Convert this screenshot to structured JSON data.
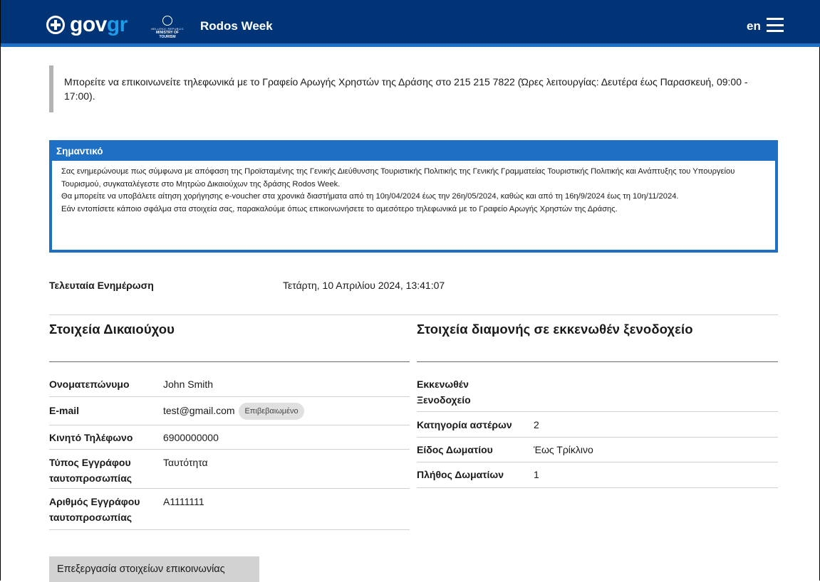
{
  "colors": {
    "header_bg": "#003476",
    "header_accent": "#1e70c4",
    "gov_accent": "#1e9ce9",
    "important_border": "#1e70c4",
    "quote_border": "#b3b3b3",
    "badge_bg": "#e0e0e0",
    "button_bg": "#d2d2d2"
  },
  "header": {
    "logo_text_a": "gov",
    "logo_text_b": "gr",
    "ministry_line1": "HELLENIC REPUBLIC",
    "ministry_line2": "MINISTRY OF TOURISM",
    "app_title": "Rodos Week",
    "language": "en",
    "menu_icon": "hamburger-icon",
    "logo_icon": "greek-emblem-icon"
  },
  "notice": {
    "text": "Μπορείτε να επικοινωνείτε τηλεφωνικά με το Γραφείο Αρωγής Χρηστών της Δράσης στο 215 215 7822 (Ώρες λειτουργίας: Δευτέρα έως Παρασκευή, 09:00 - 17:00)."
  },
  "important": {
    "title": "Σημαντικό",
    "lines": [
      "Σας ενημερώνουμε πως σύμφωνα με απόφαση της Προϊσταμένης της Γενικής Διεύθυνσης Τουριστικής Πολιτικής της Γενικής Γραμματείας Τουριστικής Πολιτικής και Ανάπτυξης του Υπουργείου Τουρισμού, συγκαταλέγεστε στο Μητρώο Δικαιούχων της δράσης Rodos Week.",
      "Θα μπορείτε να υποβάλετε αίτηση χορήγησης e-voucher στα χρονικά διαστήματα από τη 10η/04/2024 έως την 26η/05/2024, καθώς και από τη 16η/9/2024 έως τη 10η/11/2024.",
      "Εάν εντοπίσετε κάποιο σφάλμα στα στοιχεία σας, παρακαλούμε όπως επικοινωνήσετε το αμεσότερο τηλεφωνικά με το Γραφείο Αρωγής Χρηστών της Δράσης."
    ]
  },
  "last_update": {
    "label": "Τελευταία Ενημέρωση",
    "value": "Τετάρτη, 10 Απριλίου 2024, 13:41:07"
  },
  "beneficiary": {
    "title": "Στοιχεία Δικαιούχου",
    "rows": [
      {
        "key": "Ονοματεπώνυμο",
        "value": "John Smith"
      },
      {
        "key": "E-mail",
        "value": "test@gmail.com",
        "badge": "Επιβεβαιωμένο"
      },
      {
        "key": "Κινητό Τηλέφωνο",
        "value": "6900000000"
      },
      {
        "key": "Τύπος Εγγράφου ταυτοπροσωπίας",
        "value": "Ταυτότητα"
      },
      {
        "key": "Αριθμός Εγγράφου ταυτοπροσωπίας",
        "value": "A1111111"
      }
    ]
  },
  "accommodation": {
    "title": "Στοιχεία διαμονής σε εκκενωθέν ξενοδοχείο",
    "rows": [
      {
        "key": "Εκκενωθέν Ξενοδοχείο",
        "value": ""
      },
      {
        "key": "Κατηγορία αστέρων",
        "value": "2"
      },
      {
        "key": "Είδος Δωματίου",
        "value": "Έως Τρίκλινο"
      },
      {
        "key": "Πλήθος Δωματίων",
        "value": "1"
      }
    ]
  },
  "actions": {
    "edit_contact_label": "Επεξεργασία στοιχείων επικοινωνίας"
  }
}
